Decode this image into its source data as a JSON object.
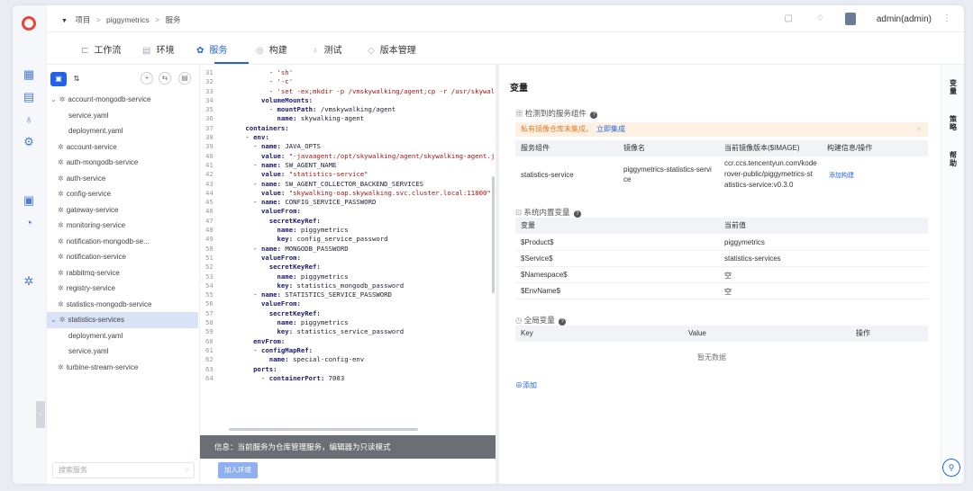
{
  "breadcrumb": {
    "items": [
      "项目",
      "piggymetrics",
      "服务"
    ]
  },
  "user": {
    "name": "admin(admin)"
  },
  "tabs": [
    {
      "label": "工作流"
    },
    {
      "label": "环境"
    },
    {
      "label": "服务"
    },
    {
      "label": "构建"
    },
    {
      "label": "测试"
    },
    {
      "label": "版本管理"
    }
  ],
  "tree": {
    "items": [
      {
        "label": "account-mongodb-service",
        "level": 0,
        "type": "service",
        "expanded": true
      },
      {
        "label": "service.yaml",
        "level": 1,
        "type": "file"
      },
      {
        "label": "deployment.yaml",
        "level": 1,
        "type": "file"
      },
      {
        "label": "account-service",
        "level": 0,
        "type": "service"
      },
      {
        "label": "auth-mongodb-service",
        "level": 0,
        "type": "service"
      },
      {
        "label": "auth-service",
        "level": 0,
        "type": "service"
      },
      {
        "label": "config-service",
        "level": 0,
        "type": "service"
      },
      {
        "label": "gateway-service",
        "level": 0,
        "type": "service"
      },
      {
        "label": "monitoring-service",
        "level": 0,
        "type": "service"
      },
      {
        "label": "notification-mongodb-se...",
        "level": 0,
        "type": "service"
      },
      {
        "label": "notification-service",
        "level": 0,
        "type": "service"
      },
      {
        "label": "rabbitmq-service",
        "level": 0,
        "type": "service"
      },
      {
        "label": "registry-service",
        "level": 0,
        "type": "service"
      },
      {
        "label": "statistics-mongodb-service",
        "level": 0,
        "type": "service"
      },
      {
        "label": "statistics-services",
        "level": 0,
        "type": "service",
        "expanded": true,
        "selected": true
      },
      {
        "label": "deployment.yaml",
        "level": 1,
        "type": "file"
      },
      {
        "label": "service.yaml",
        "level": 1,
        "type": "file"
      },
      {
        "label": "turbine-stream-service",
        "level": 0,
        "type": "service"
      }
    ],
    "search_placeholder": "搜索服务"
  },
  "editor": {
    "lines": [
      {
        "n": "31",
        "indent": 12,
        "parts": [
          [
            "p",
            "- "
          ],
          [
            "s",
            "'sh'"
          ]
        ]
      },
      {
        "n": "32",
        "indent": 12,
        "parts": [
          [
            "p",
            "- "
          ],
          [
            "s",
            "'-c'"
          ]
        ]
      },
      {
        "n": "33",
        "indent": 12,
        "parts": [
          [
            "p",
            "- "
          ],
          [
            "s",
            "'set -ex;mkdir -p /vmskywalking/agent;cp -r /usr/skywalki"
          ]
        ]
      },
      {
        "n": "34",
        "indent": 10,
        "parts": [
          [
            "k",
            "volumeMounts:"
          ]
        ]
      },
      {
        "n": "35",
        "indent": 12,
        "parts": [
          [
            "p",
            "- "
          ],
          [
            "k",
            "mountPath: "
          ],
          [
            "p",
            "/vmskywalking/agent"
          ]
        ]
      },
      {
        "n": "36",
        "indent": 14,
        "parts": [
          [
            "k",
            "name: "
          ],
          [
            "p",
            "skywalking-agent"
          ]
        ]
      },
      {
        "n": "37",
        "indent": 6,
        "parts": [
          [
            "k",
            "containers:"
          ]
        ]
      },
      {
        "n": "38",
        "indent": 6,
        "parts": [
          [
            "p",
            "- "
          ],
          [
            "k",
            "env:"
          ]
        ]
      },
      {
        "n": "39",
        "indent": 8,
        "parts": [
          [
            "p",
            "- "
          ],
          [
            "k",
            "name: "
          ],
          [
            "p",
            "JAVA_OPTS"
          ]
        ]
      },
      {
        "n": "40",
        "indent": 10,
        "parts": [
          [
            "k",
            "value: "
          ],
          [
            "s",
            "\"-javaagent:/opt/skywalking/agent/skywalking-agent.jar"
          ]
        ]
      },
      {
        "n": "41",
        "indent": 8,
        "parts": [
          [
            "p",
            "- "
          ],
          [
            "k",
            "name: "
          ],
          [
            "p",
            "SW_AGENT_NAME"
          ]
        ]
      },
      {
        "n": "42",
        "indent": 10,
        "parts": [
          [
            "k",
            "value: "
          ],
          [
            "s",
            "\"statistics-service\""
          ]
        ]
      },
      {
        "n": "43",
        "indent": 8,
        "parts": [
          [
            "p",
            "- "
          ],
          [
            "k",
            "name: "
          ],
          [
            "p",
            "SW_AGENT_COLLECTOR_BACKEND_SERVICES"
          ]
        ]
      },
      {
        "n": "44",
        "indent": 10,
        "parts": [
          [
            "k",
            "value: "
          ],
          [
            "s",
            "\"skywalking-oap.skywalking.svc.cluster.local:11800\""
          ]
        ]
      },
      {
        "n": "45",
        "indent": 8,
        "parts": [
          [
            "p",
            "- "
          ],
          [
            "k",
            "name: "
          ],
          [
            "p",
            "CONFIG_SERVICE_PASSWORD"
          ]
        ]
      },
      {
        "n": "46",
        "indent": 10,
        "parts": [
          [
            "k",
            "valueFrom:"
          ]
        ]
      },
      {
        "n": "47",
        "indent": 12,
        "parts": [
          [
            "k",
            "secretKeyRef:"
          ]
        ]
      },
      {
        "n": "48",
        "indent": 14,
        "parts": [
          [
            "k",
            "name: "
          ],
          [
            "p",
            "piggymetrics"
          ]
        ]
      },
      {
        "n": "49",
        "indent": 14,
        "parts": [
          [
            "k",
            "key: "
          ],
          [
            "p",
            "config_service_password"
          ]
        ]
      },
      {
        "n": "50",
        "indent": 8,
        "parts": [
          [
            "p",
            "- "
          ],
          [
            "k",
            "name: "
          ],
          [
            "p",
            "MONGODB_PASSWORD"
          ]
        ]
      },
      {
        "n": "51",
        "indent": 10,
        "parts": [
          [
            "k",
            "valueFrom:"
          ]
        ]
      },
      {
        "n": "52",
        "indent": 12,
        "parts": [
          [
            "k",
            "secretKeyRef:"
          ]
        ]
      },
      {
        "n": "53",
        "indent": 14,
        "parts": [
          [
            "k",
            "name: "
          ],
          [
            "p",
            "piggymetrics"
          ]
        ]
      },
      {
        "n": "54",
        "indent": 14,
        "parts": [
          [
            "k",
            "key: "
          ],
          [
            "p",
            "statistics_mongodb_password"
          ]
        ]
      },
      {
        "n": "55",
        "indent": 8,
        "parts": [
          [
            "p",
            "- "
          ],
          [
            "k",
            "name: "
          ],
          [
            "p",
            "STATISTICS_SERVICE_PASSWORD"
          ]
        ]
      },
      {
        "n": "56",
        "indent": 10,
        "parts": [
          [
            "k",
            "valueFrom:"
          ]
        ]
      },
      {
        "n": "57",
        "indent": 12,
        "parts": [
          [
            "k",
            "secretKeyRef:"
          ]
        ]
      },
      {
        "n": "58",
        "indent": 14,
        "parts": [
          [
            "k",
            "name: "
          ],
          [
            "p",
            "piggymetrics"
          ]
        ]
      },
      {
        "n": "59",
        "indent": 14,
        "parts": [
          [
            "k",
            "key: "
          ],
          [
            "p",
            "statistics_service_password"
          ]
        ]
      },
      {
        "n": "60",
        "indent": 8,
        "parts": [
          [
            "k",
            "envFrom:"
          ]
        ]
      },
      {
        "n": "61",
        "indent": 8,
        "parts": [
          [
            "p",
            "- "
          ],
          [
            "k",
            "configMapRef:"
          ]
        ]
      },
      {
        "n": "62",
        "indent": 12,
        "parts": [
          [
            "k",
            "name: "
          ],
          [
            "p",
            "special-config-env"
          ]
        ]
      },
      {
        "n": "63",
        "indent": 8,
        "parts": [
          [
            "k",
            "ports:"
          ]
        ]
      },
      {
        "n": "64",
        "indent": 10,
        "parts": [
          [
            "p",
            "- "
          ],
          [
            "k",
            "containerPort: "
          ],
          [
            "p",
            "7003"
          ]
        ]
      }
    ],
    "info": "信息：当前服务为仓库管理服务，编辑器为只读模式",
    "join_button": "加入环境"
  },
  "vars": {
    "title": "变量",
    "detected_title": "检测到的服务组件",
    "warn_text": "私有镜像仓库未集成，",
    "warn_link": "立即集成",
    "detected_headers": [
      "服务组件",
      "镜像名",
      "当前镜像版本($IMAGE)",
      "构建信息/操作"
    ],
    "detected_row": {
      "component": "statistics-service",
      "image": [
        "piggymetrics-statistics-servi",
        "ce"
      ],
      "version": [
        "ccr.ccs.tencentyun.com/kode",
        "rover-public/piggymetrics-st",
        "atistics-service:v0.3.0"
      ],
      "action": "添加构建"
    },
    "system_title": "系统内置变量",
    "system_headers": [
      "变量",
      "当前值"
    ],
    "system_rows": [
      {
        "k": "$Product$",
        "v": "piggymetrics"
      },
      {
        "k": "$Service$",
        "v": "statistics-services"
      },
      {
        "k": "$Namespace$",
        "v": "空"
      },
      {
        "k": "$EnvName$",
        "v": "空"
      }
    ],
    "global_title": "全局变量",
    "global_headers": [
      "Key",
      "Value",
      "操作"
    ],
    "no_data": "暂无数据",
    "add": "⊕添加"
  },
  "right_tabs": [
    [
      "变",
      "量"
    ],
    [
      "策",
      "略"
    ],
    [
      "帮",
      "助"
    ]
  ]
}
